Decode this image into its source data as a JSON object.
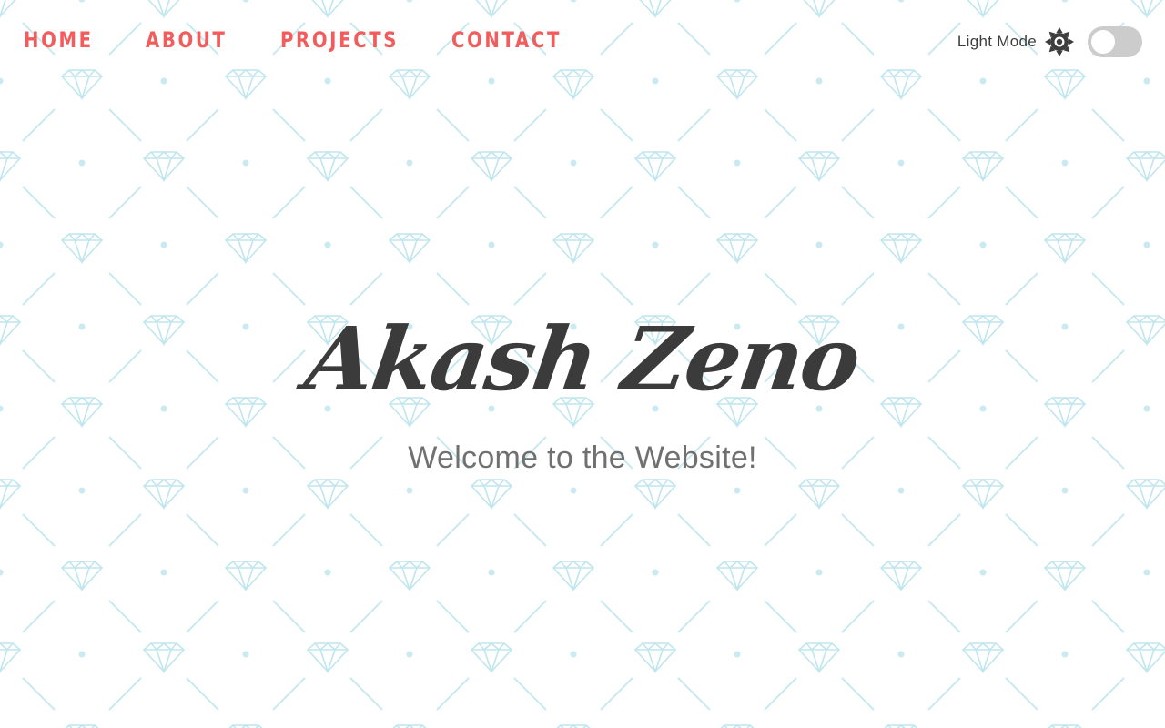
{
  "nav": {
    "items": [
      {
        "label": "HOME"
      },
      {
        "label": "ABOUT"
      },
      {
        "label": "PROJECTS"
      },
      {
        "label": "CONTACT"
      }
    ]
  },
  "theme": {
    "mode_label": "Light Mode",
    "icon": "sun-icon",
    "toggle_on": false
  },
  "hero": {
    "title": "Akash Zeno",
    "subtitle": "Welcome to the Website!"
  },
  "colors": {
    "nav_accent": "#f25c5c",
    "pattern": "#c9eaf0",
    "title": "#3b3b3b",
    "subtitle": "#707070",
    "toggle_track": "#cccccc"
  }
}
